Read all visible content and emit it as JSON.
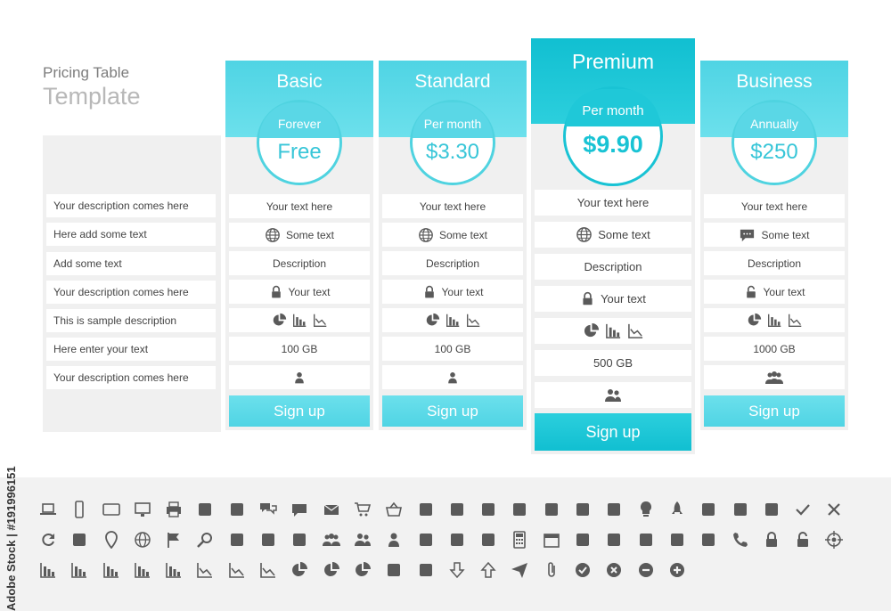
{
  "title": {
    "line1": "Pricing Table",
    "line2": "Template"
  },
  "descriptions": [
    "Your description comes here",
    "Here add some text",
    "Add some text",
    "Your description comes here",
    "This is sample description",
    "Here enter your text",
    "Your description comes here"
  ],
  "plans": [
    {
      "name": "Basic",
      "period": "Forever",
      "price": "Free",
      "text": "Your text here",
      "some_text": "Some text",
      "some_icon": "globe-icon",
      "description": "Description",
      "your_text": "Your text",
      "lock_icon": "lock-icon",
      "storage": "100 GB",
      "users_icon": "user-icon",
      "signup": "Sign up"
    },
    {
      "name": "Standard",
      "period": "Per month",
      "price": "$3.30",
      "text": "Your text here",
      "some_text": "Some text",
      "some_icon": "globe-icon",
      "description": "Description",
      "your_text": "Your text",
      "lock_icon": "lock-icon",
      "storage": "100 GB",
      "users_icon": "user-icon",
      "signup": "Sign up"
    },
    {
      "name": "Premium",
      "period": "Per month",
      "price": "$9.90",
      "text": "Your text here",
      "some_text": "Some text",
      "some_icon": "globe-icon",
      "description": "Description",
      "your_text": "Your text",
      "lock_icon": "lock-icon",
      "storage": "500 GB",
      "users_icon": "users-icon",
      "signup": "Sign up",
      "highlighted": true
    },
    {
      "name": "Business",
      "period": "Annually",
      "price": "$250",
      "text": "Your text here",
      "some_text": "Some text",
      "some_icon": "speech-bubble-icon",
      "description": "Description",
      "your_text": "Your text",
      "lock_icon": "unlock-icon",
      "storage": "1000 GB",
      "users_icon": "group-icon",
      "signup": "Sign up"
    }
  ],
  "colors": {
    "accent_light": "#5ad7e6",
    "accent_dark": "#19c3d4",
    "panel": "#f0f0f0"
  },
  "side_watermark": "Adobe Stock | #191996151",
  "icon_set": [
    "laptop-icon",
    "phone-icon",
    "tablet-icon",
    "monitor-icon",
    "printer-icon",
    "mouse-icon",
    "support-icon",
    "chat-bubbles-icon",
    "speech-bubble-icon",
    "mail-icon",
    "cart-icon",
    "basket-icon",
    "credit-card-icon",
    "cash-icon",
    "gift-icon",
    "box-icon",
    "truck-icon",
    "piggy-bank-icon",
    "money-bag-icon",
    "lightbulb-icon",
    "rocket-icon",
    "flask-icon",
    "graduation-cap-icon",
    "signpost-icon",
    "check-icon",
    "cross-icon",
    "refresh-icon",
    "pointing-hand-icon",
    "map-pin-icon",
    "globe-icon",
    "flag-icon",
    "magnifier-icon",
    "stars-icon",
    "settings-badge-icon",
    "new-badge-icon",
    "group-icon",
    "users-icon",
    "user-icon",
    "user-tie-icon",
    "battery-icon",
    "notebook-icon",
    "calculator-icon",
    "calendar-icon",
    "document-icon",
    "address-book-icon",
    "clipboard-icon",
    "factory-icon",
    "books-icon",
    "phone-handset-icon",
    "lock-icon",
    "unlock-icon",
    "target-icon",
    "bar-chart-icon",
    "bar-chart-icon",
    "bar-chart-icon",
    "bar-chart-icon",
    "bar-chart-icon",
    "line-chart-icon",
    "line-chart-icon",
    "line-chart-icon",
    "pie-chart-icon",
    "pie-chart-icon",
    "pie-chart-icon",
    "org-chart-icon",
    "tree-icon",
    "arrow-down-icon",
    "arrow-up-icon",
    "paper-plane-icon",
    "paperclip-icon",
    "check-circle-icon",
    "cross-circle-icon",
    "minus-circle-icon",
    "plus-circle-icon"
  ]
}
